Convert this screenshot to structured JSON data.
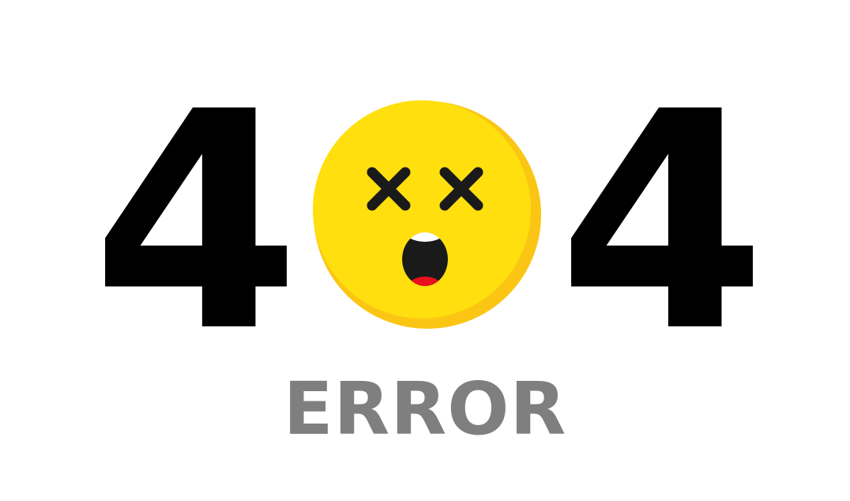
{
  "code": {
    "first_digit": "4",
    "last_digit": "4"
  },
  "label": "ERROR",
  "colors": {
    "digits": "#000000",
    "label": "#7f7f7f",
    "face": "#ffdf0e",
    "face_shade": "#fbc613",
    "features": "#1a1a1a",
    "tongue": "#e8101e",
    "teeth": "#ffffff",
    "background": "#ffffff"
  },
  "icons": {
    "emoji": "dizzy-face-icon"
  }
}
